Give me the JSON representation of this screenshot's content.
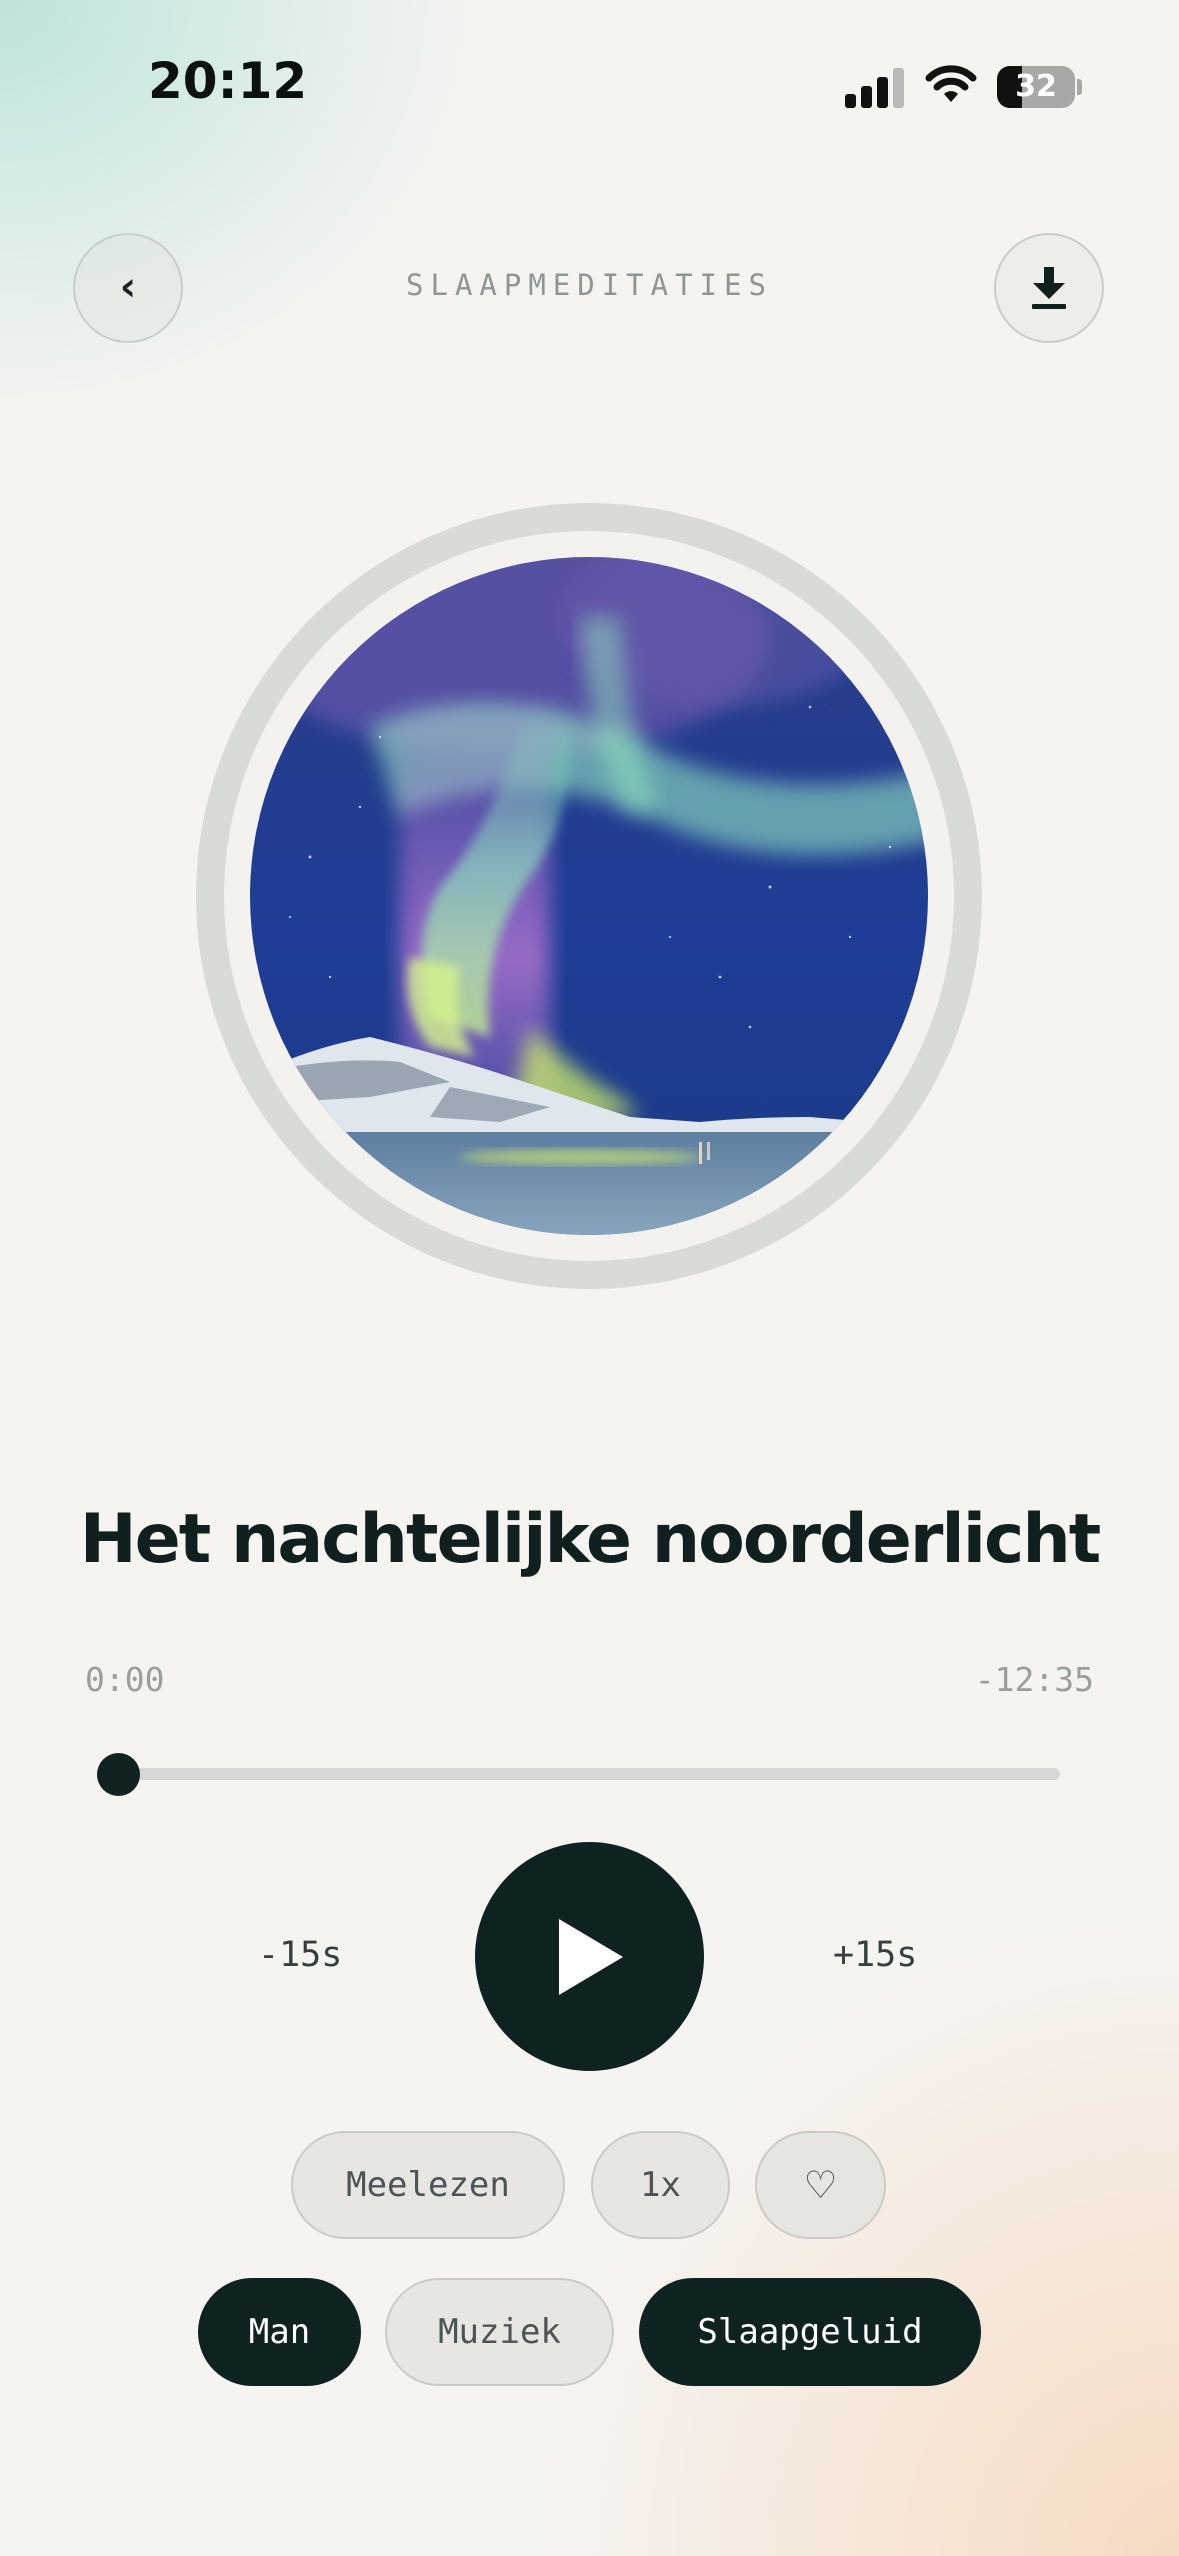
{
  "status_bar": {
    "time": "20:12",
    "battery": "32"
  },
  "header": {
    "title": "SLAAPMEDITATIES",
    "back_glyph": "‹"
  },
  "track": {
    "title": "Het nachtelijke noorderlicht"
  },
  "player": {
    "elapsed": "0:00",
    "remaining": "-12:35",
    "progress": 0,
    "skip_back": "-15s",
    "skip_forward": "+15s"
  },
  "options": {
    "read_along": "Meelezen",
    "speed": "1x",
    "favorite_glyph": "♡"
  },
  "toggles": [
    {
      "label": "Man",
      "active": true
    },
    {
      "label": "Muziek",
      "active": false
    },
    {
      "label": "Slaapgeluid",
      "active": true
    }
  ],
  "icons": {
    "back": "chevron-left-icon",
    "download": "download-icon",
    "play": "play-icon",
    "favorite": "heart-icon",
    "artwork": "aurora-artwork"
  },
  "colors": {
    "dark": "#0f2222",
    "accent_teal": "#aadcd4",
    "accent_peach": "#f6d6ba",
    "background": "#f6f4f1"
  }
}
